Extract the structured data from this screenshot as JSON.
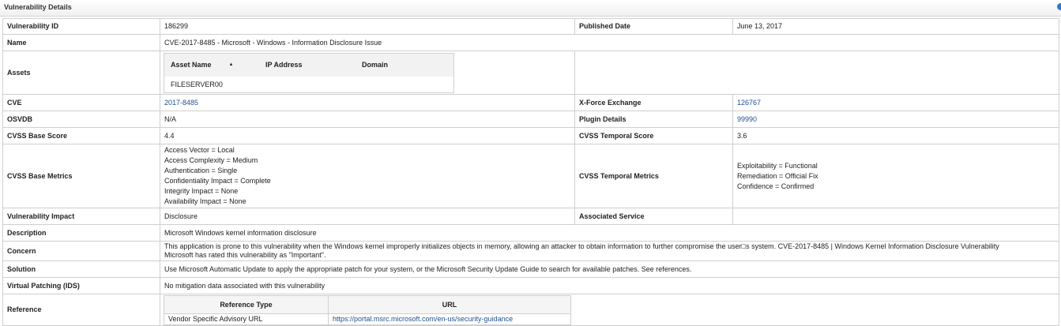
{
  "panel": {
    "title": "Vulnerability Details"
  },
  "rows": {
    "vuln_id": {
      "label": "Vulnerability ID",
      "value": "186299",
      "label2": "Published Date",
      "value2": "June 13, 2017"
    },
    "name": {
      "label": "Name",
      "value": "CVE-2017-8485 - Microsoft - Windows - Information Disclosure Issue"
    },
    "assets": {
      "label": "Assets",
      "columns": [
        "Asset Name",
        "IP Address",
        "Domain"
      ],
      "rows": [
        [
          "FILESERVER00",
          "",
          ""
        ]
      ]
    },
    "cve": {
      "label": "CVE",
      "value": "2017-8485",
      "label2": "X-Force Exchange",
      "value2": "126767"
    },
    "osvdb": {
      "label": "OSVDB",
      "value": "N/A",
      "label2": "Plugin Details",
      "value2": "99990"
    },
    "cvss_base": {
      "label": "CVSS Base Score",
      "value": "4.4",
      "label2": "CVSS Temporal Score",
      "value2": "3.6"
    },
    "cvss_metrics": {
      "label": "CVSS Base Metrics",
      "lines": [
        "Access Vector = Local",
        "Access Complexity = Medium",
        "Authentication = Single",
        "Confidentiality Impact = Complete",
        "Integrity Impact = None",
        "Availability Impact = None"
      ],
      "label2": "CVSS Temporal Metrics",
      "lines2": [
        "Exploitability = Functional",
        "Remediation = Official Fix",
        "Confidence = Confirmed"
      ]
    },
    "impact": {
      "label": "Vulnerability Impact",
      "value": "Disclosure",
      "label2": "Associated Service",
      "value2": ""
    },
    "description": {
      "label": "Description",
      "value": "Microsoft Windows kernel information disclosure"
    },
    "concern": {
      "label": "Concern",
      "line1": "This application is prone to this vulnerability when the Windows kernel improperly initializes objects in memory, allowing an attacker to obtain information to further compromise the user□s system. CVE-2017-8485 | Windows Kernel Information Disclosure Vulnerability",
      "line2": "Microsoft has rated this vulnerability as \"Important\"."
    },
    "solution": {
      "label": "Solution",
      "value": "Use Microsoft Automatic Update to apply the appropriate patch for your system, or the Microsoft Security Update Guide to search for available patches. See references."
    },
    "virtual_patching": {
      "label": "Virtual Patching (IDS)",
      "value": "No mitigation data associated with this vulnerability"
    },
    "reference": {
      "label": "Reference",
      "columns": [
        "Reference Type",
        "URL"
      ],
      "rows": [
        [
          "Vendor Specific Advisory URL",
          "https://portal.msrc.microsoft.com/en-us/security-guidance"
        ]
      ]
    }
  }
}
